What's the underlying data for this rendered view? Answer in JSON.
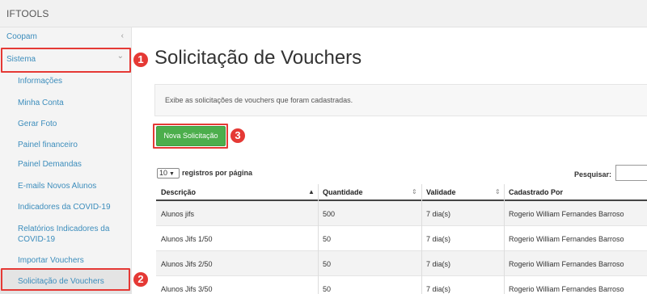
{
  "app": {
    "brand": "IFTOOLS"
  },
  "sidebar": {
    "items": [
      {
        "label": "Coopam",
        "chevron": "‹"
      },
      {
        "label": "Sistema",
        "chevron": "⌄"
      }
    ],
    "subitems": [
      {
        "label": "Informações"
      },
      {
        "label": "Minha Conta"
      },
      {
        "label": "Gerar Foto"
      },
      {
        "label": "Painel financeiro"
      },
      {
        "label": "Painel Demandas"
      },
      {
        "label": "E-mails Novos Alunos"
      },
      {
        "label": "Indicadores da COVID-19"
      },
      {
        "label": "Relatórios Indicadores da COVID-19"
      },
      {
        "label": "Importar Vouchers"
      },
      {
        "label": "Solicitação de Vouchers"
      }
    ]
  },
  "annotations": [
    "1",
    "2",
    "3"
  ],
  "page": {
    "title": "Solicitação de Vouchers",
    "description": "Exibe as solicitações de vouchers que foram cadastradas.",
    "new_button": "Nova Solicitação"
  },
  "table_controls": {
    "length_value": "10",
    "length_suffix": "registros por página",
    "search_label": "Pesquisar:",
    "search_value": ""
  },
  "table": {
    "columns": [
      "Descrição",
      "Quantidade",
      "Validade",
      "Cadastrado Por"
    ],
    "sort_icons": [
      "▲",
      "⇕",
      "⇕"
    ],
    "rows": [
      [
        "Alunos jifs",
        "500",
        "7 dia(s)",
        "Rogerio William Fernandes Barroso"
      ],
      [
        "Alunos Jifs 1/50",
        "50",
        "7 dia(s)",
        "Rogerio William Fernandes Barroso"
      ],
      [
        "Alunos Jifs 2/50",
        "50",
        "7 dia(s)",
        "Rogerio William Fernandes Barroso"
      ],
      [
        "Alunos Jifs 3/50",
        "50",
        "7 dia(s)",
        "Rogerio William Fernandes Barroso"
      ]
    ]
  },
  "colors": {
    "accent_link": "#3c8dbc",
    "highlight_red": "#e53935",
    "button_green": "#4cae4c"
  }
}
